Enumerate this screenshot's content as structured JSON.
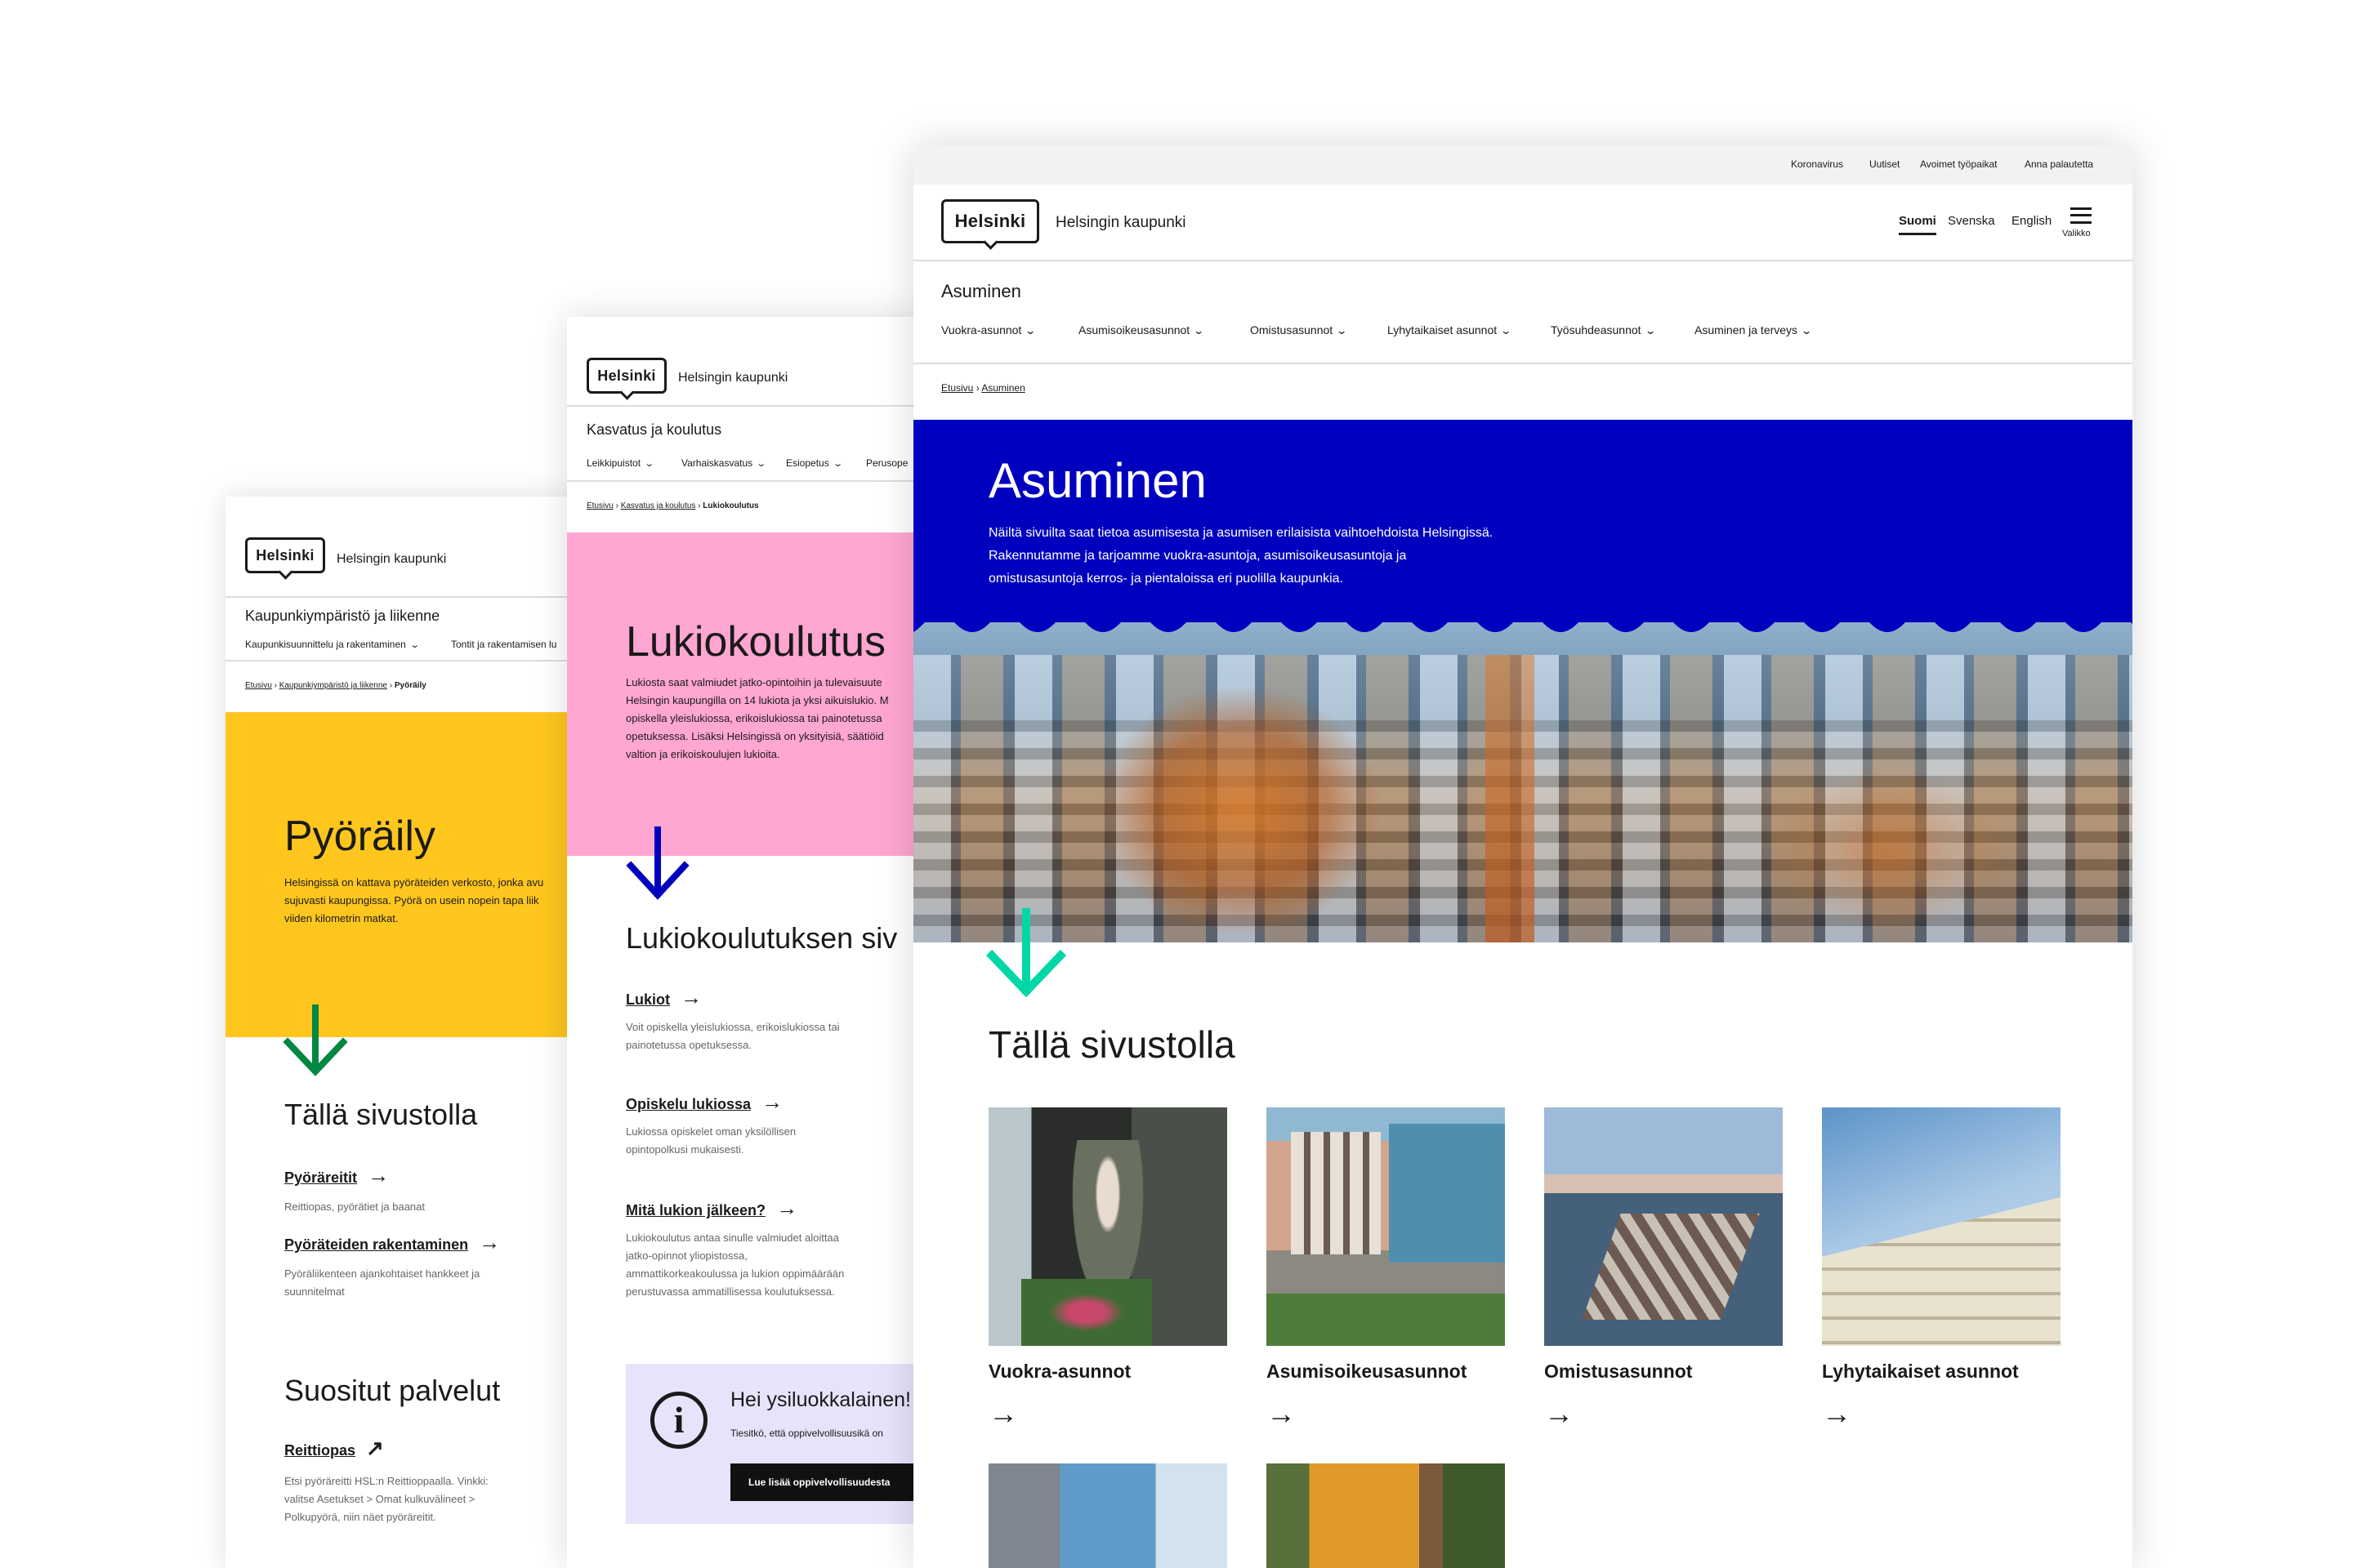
{
  "brand": {
    "logo": "Helsinki",
    "city": "Helsingin kaupunki"
  },
  "colors": {
    "yellow": "#ffc61e",
    "pink": "#ffa6d2",
    "blue": "#0000bf",
    "dark_green": "#008741",
    "mint": "#00d7a7",
    "navy": "#0000bf"
  },
  "c1": {
    "section": "Kaupunkiympäristö ja liikenne",
    "nav": [
      "Kaupunkisuunnittelu ja rakentaminen",
      "Tontit ja rakentamisen lu"
    ],
    "crumb": [
      "Etusivu",
      "Kaupunkiympäristö ja liikenne",
      "Pyöräily"
    ],
    "title": "Pyöräily",
    "lead": [
      "Helsingissä on kattava pyöräteiden verkosto, jonka avu",
      "sujuvasti kaupungissa. Pyörä on usein nopein tapa liik",
      "viiden kilometrin matkat."
    ],
    "section_title": "Tällä sivustolla",
    "links": [
      {
        "label": "Pyöräreitit",
        "desc": [
          "Reittiopas, pyörätiet ja baanat"
        ]
      },
      {
        "label": "Pyöräteiden rakentaminen",
        "desc": [
          "Pyöräliikenteen ajankohtaiset hankkeet ja",
          "suunnitelmat"
        ]
      }
    ],
    "popular_title": "Suositut palvelut",
    "popular": {
      "label": "Reittiopas",
      "desc": [
        "Etsi pyöräreitti HSL:n Reittioppaalla. Vinkki:",
        "valitse Asetukset > Omat kulkuvälineet >",
        "Polkupyörä, niin näet pyöräreitit."
      ]
    }
  },
  "c2": {
    "section": "Kasvatus ja koulutus",
    "nav": [
      "Leikkipuistot",
      "Varhaiskasvatus",
      "Esiopetus",
      "Perusope"
    ],
    "crumb": [
      "Etusivu",
      "Kasvatus ja koulutus",
      "Lukiokoulutus"
    ],
    "title": "Lukiokoulutus",
    "lead": [
      "Lukiosta saat valmiudet jatko-opintoihin ja tulevaisuute",
      "Helsingin kaupungilla on 14 lukiota ja yksi aikuislukio. M",
      "opiskella yleislukiossa, erikoislukiossa tai painotetussa",
      "opetuksessa. Lisäksi Helsingissä on yksityisiä, säätiöid",
      "valtion ja erikoiskoulujen lukioita."
    ],
    "section_title": "Lukiokoulutuksen siv",
    "links": [
      {
        "label": "Lukiot",
        "desc": [
          "Voit opiskella yleislukiossa, erikoislukiossa tai",
          "painotetussa opetuksessa."
        ]
      },
      {
        "label": "Opiskelu lukiossa",
        "desc": [
          "Lukiossa opiskelet oman yksilöllisen",
          "opintopolkusi mukaisesti."
        ]
      },
      {
        "label": "Mitä lukion jälkeen?",
        "desc": [
          "Lukiokoulutus antaa sinulle valmiudet aloittaa",
          "jatko-opinnot yliopistossa,",
          "ammattikorkeakoulussa ja lukion oppimäärään",
          "perustuvassa ammatillisessa koulutuksessa."
        ]
      }
    ],
    "notice": {
      "title": "Hei ysiluokkalainen!",
      "text": "Tiesitkö, että oppivelvollisuusikä on",
      "button": "Lue lisää oppivelvollisuudesta"
    }
  },
  "c3": {
    "top_links": [
      "Koronavirus",
      "Uutiset",
      "Avoimet työpaikat",
      "Anna palautetta"
    ],
    "languages": [
      "Suomi",
      "Svenska",
      "English"
    ],
    "menu_label": "Valikko",
    "section": "Asuminen",
    "nav": [
      "Vuokra-asunnot",
      "Asumisoikeusasunnot",
      "Omistusasunnot",
      "Lyhytaikaiset asunnot",
      "Työsuhdeasunnot",
      "Asuminen ja terveys"
    ],
    "crumb": [
      "Etusivu",
      "Asuminen"
    ],
    "title": "Asuminen",
    "lead": [
      "Näiltä sivuilta saat tietoa asumisesta ja asumisen erilaisista vaihtoehdoista Helsingissä.",
      "Rakennutamme ja tarjoamme vuokra-asuntoja, asumisoikeusasuntoja ja",
      "omistusasuntoja kerros- ja pientaloissa eri puolilla kaupunkia."
    ],
    "section_title": "Tällä sivustolla",
    "tiles": [
      "Vuokra-asunnot",
      "Asumisoikeusasunnot",
      "Omistusasunnot",
      "Lyhytaikaiset asunnot"
    ]
  },
  "icons": {
    "arrow": "→",
    "external": "↗",
    "chevron": "⌄",
    "down": "↓",
    "info": "i"
  }
}
